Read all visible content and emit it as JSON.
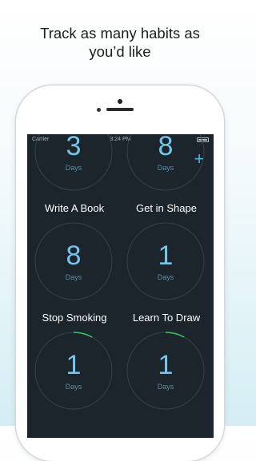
{
  "headline": {
    "line1": "Track as many habits as",
    "line2": "you’d like"
  },
  "status_bar": {
    "carrier": "Carrier",
    "time": "3:24 PM"
  },
  "toolbar": {
    "add_label": "+"
  },
  "habits": [
    {
      "count": "3",
      "unit": "Days",
      "name": "Write A Book",
      "progress": 0.08
    },
    {
      "count": "8",
      "unit": "Days",
      "name": "Get in Shape",
      "progress": 0.08
    },
    {
      "count": "8",
      "unit": "Days",
      "name": "Stop Smoking",
      "progress": 0.0
    },
    {
      "count": "1",
      "unit": "Days",
      "name": "Learn To Draw",
      "progress": 0.0
    },
    {
      "count": "1",
      "unit": "Days",
      "name": "",
      "progress": 0.08
    },
    {
      "count": "1",
      "unit": "Days",
      "name": "",
      "progress": 0.08
    }
  ],
  "colors": {
    "screen_bg": "#1d252c",
    "ring": "#35414a",
    "ring_progress": "#3fbf5f",
    "count_text": "#76c6ec",
    "accent": "#46b3e6"
  }
}
